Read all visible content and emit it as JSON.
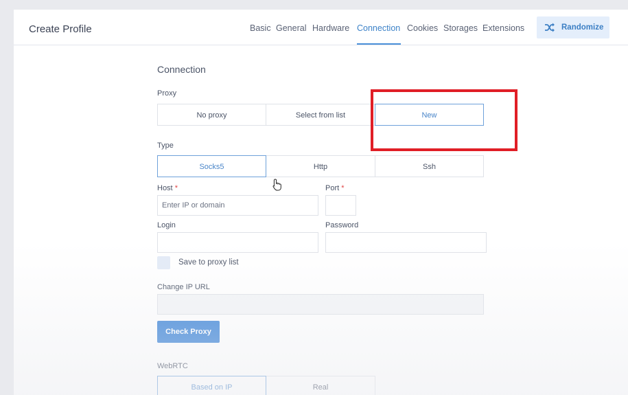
{
  "header": {
    "title": "Create Profile",
    "tabs": [
      {
        "label": "Basic",
        "active": false
      },
      {
        "label": "General",
        "active": false
      },
      {
        "label": "Hardware",
        "active": false
      },
      {
        "label": "Connection",
        "active": true
      },
      {
        "label": "Cookies",
        "active": false
      },
      {
        "label": "Storages",
        "active": false
      },
      {
        "label": "Extensions",
        "active": false
      }
    ],
    "randomize": {
      "label": "Randomize",
      "icon": "shuffle-icon"
    }
  },
  "connection": {
    "title": "Connection",
    "proxy": {
      "label": "Proxy",
      "options": [
        "No proxy",
        "Select from list",
        "New"
      ],
      "selected": "New"
    },
    "type": {
      "label": "Type",
      "options": [
        "Socks5",
        "Http",
        "Ssh"
      ],
      "selected": "Socks5"
    },
    "host": {
      "label": "Host",
      "required_mark": "*",
      "value": "",
      "placeholder": "Enter IP or domain"
    },
    "port": {
      "label": "Port",
      "required_mark": "*",
      "value": ""
    },
    "login": {
      "label": "Login",
      "value": ""
    },
    "password": {
      "label": "Password",
      "value": ""
    },
    "save_to_list": {
      "label": "Save to proxy list",
      "checked": false
    },
    "change_ip_url": {
      "label": "Change IP URL",
      "value": ""
    },
    "check_proxy": {
      "label": "Check Proxy"
    },
    "webrtc": {
      "label": "WebRTC",
      "options": [
        "Based on IP",
        "Real"
      ],
      "selected": "Based on IP"
    }
  },
  "colors": {
    "accent": "#3f86d8",
    "highlight": "#e01e26"
  }
}
